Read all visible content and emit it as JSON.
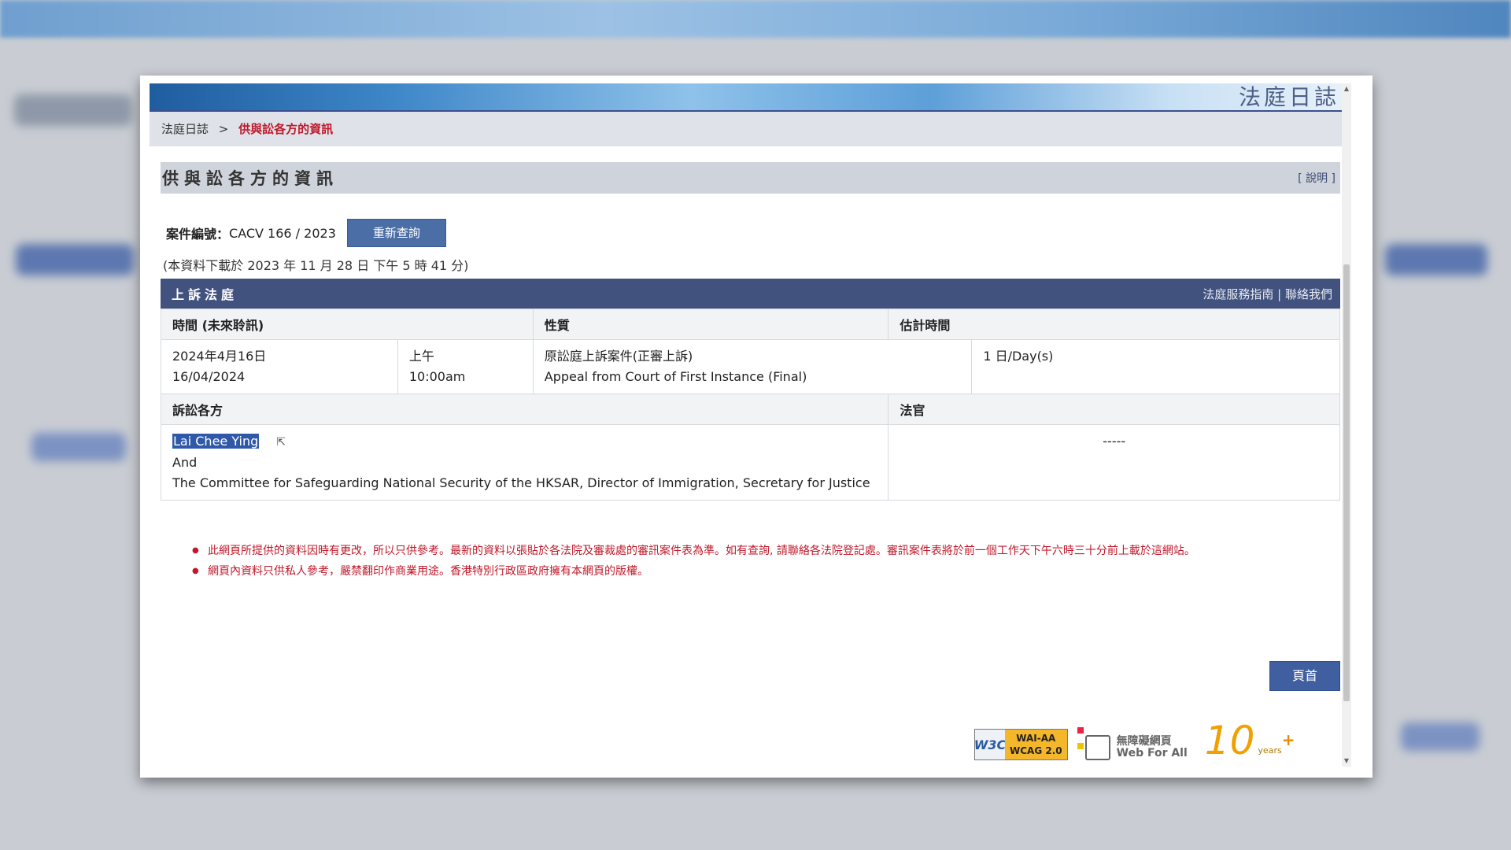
{
  "site_title": "法庭日誌",
  "breadcrumb": {
    "home": "法庭日誌",
    "separator": ">",
    "current": "供與訟各方的資訊"
  },
  "section": {
    "title": "供與訟各方的資訊",
    "help_link": "[ 說明 ]"
  },
  "case": {
    "label": "案件編號：",
    "number": "CACV 166 / 2023",
    "requery_button": "重新查詢",
    "download_note": "(本資料下載於 2023 年 11 月 28 日 下午 5 時 41 分)"
  },
  "court": {
    "name": "上訴法庭",
    "links": {
      "guide": "法庭服務指南",
      "divider": "|",
      "contact": "聯絡我們"
    }
  },
  "hearing": {
    "headers": {
      "time": "時間 (未來聆訊)",
      "nature": "性質",
      "estimated": "估計時間"
    },
    "date_zh": "2024年4月16日",
    "date_num": "16/04/2024",
    "period": "上午",
    "time": "10:00am",
    "nature_zh": "原訟庭上訴案件(正審上訴)",
    "nature_en": "Appeal from Court of First Instance (Final)",
    "estimated": "1 日/Day(s)"
  },
  "parties": {
    "headers": {
      "parties": "訴訟各方",
      "judge": "法官"
    },
    "party1": "Lai Chee Ying",
    "conjunction": "And",
    "party2": "The Committee for Safeguarding National Security of the HKSAR, Director of Immigration, Secretary for Justice",
    "judge": "-----"
  },
  "notes": [
    "此網頁所提供的資料因時有更改，所以只供參考。最新的資料以張貼於各法院及審裁處的審訊案件表為準。如有查詢, 請聯絡各法院登記處。審訊案件表將於前一個工作天下午六時三十分前上載於這網站。",
    "網頁內資料只供私人參考，嚴禁翻印作商業用途。香港特別行政區政府擁有本網頁的版權。"
  ],
  "home_button": "頁首",
  "badges": {
    "w3c": "W3C",
    "wcag_line1": "WAI-AA",
    "wcag_line2": "WCAG 2.0",
    "wfa_zh": "無障礙網頁",
    "wfa_en": "Web For All",
    "years_big": "10",
    "years_small": "years",
    "years_plus": "+"
  },
  "colors": {
    "header_bar": "#42527f",
    "accent_red": "#c0182a",
    "button": "#4c6ea6"
  }
}
